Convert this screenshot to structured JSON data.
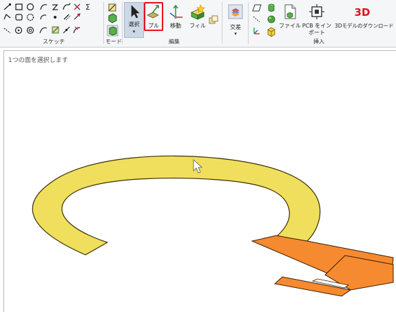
{
  "ribbon": {
    "groups": {
      "sketch": "スケッチ",
      "mode": "モード",
      "edit": "編集",
      "insert": "挿入"
    },
    "buttons": {
      "select": "選択",
      "pull": "プル",
      "move": "移動",
      "fill": "フィル",
      "intersect": "交差",
      "file": "ファイル",
      "pcb_import_line1": "PCB をイン",
      "pcb_import_line2": "ポート",
      "download_3d": "3Dモデルのダウンロード"
    },
    "download_3d_icon_text": "3D",
    "sketch_sum_glyph": "Σ",
    "dropdown_glyph": "▾"
  },
  "viewport": {
    "status_hint": "1つの面を選択します"
  },
  "colors": {
    "arc_fill": "#efdf5c",
    "pad_fill": "#f58a30",
    "highlight": "#e8101a",
    "accent_3d": "#d9141c"
  }
}
